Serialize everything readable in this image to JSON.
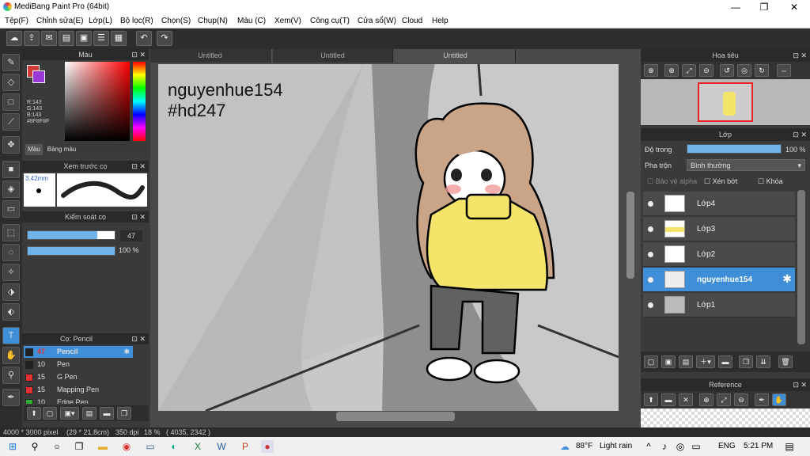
{
  "window": {
    "title": "MediBang Paint Pro (64bit)",
    "min": "—",
    "max": "❐",
    "close": "✕"
  },
  "menu": [
    "Tệp(F)",
    "Chỉnh sửa(E)",
    "Lớp(L)",
    "Bộ lọc(R)",
    "Chọn(S)",
    "Chụp(N)",
    "Màu (C)",
    "Xem(V)",
    "Công cụ(T)",
    "Cửa sổ(W)",
    "Cloud",
    "Help"
  ],
  "tabs": [
    "Untitled",
    "Untitled",
    "Untitled"
  ],
  "color_panel": {
    "title": "Màu",
    "r": "R:143",
    "g": "G:143",
    "b": "B:143",
    "hex": "#8F8F8F",
    "tab1": "Màu",
    "tab2": "Bảng màu",
    "fg": "#d33a3a",
    "bg": "#9b3ad6"
  },
  "brush_preview": {
    "title": "Xem trước cọ",
    "size": "3.42mm"
  },
  "brush_control": {
    "title": "Kiểm soát cọ",
    "size_value": "47",
    "opacity_value": "100 %",
    "size_fraction": 0.8,
    "opacity_fraction": 1.0
  },
  "brushes": {
    "title": "Cọ: Pencil",
    "items": [
      {
        "size": "47",
        "name": "Pencil",
        "color": "#222222"
      },
      {
        "size": "10",
        "name": "Pen",
        "color": "#222222"
      },
      {
        "size": "15",
        "name": "G Pen",
        "color": "#e03030"
      },
      {
        "size": "15",
        "name": "Mapping Pen",
        "color": "#e03030"
      },
      {
        "size": "10",
        "name": "Edge Pen",
        "color": "#30b030"
      }
    ]
  },
  "canvas_text": {
    "line1": "nguyenhue154",
    "line2": "#hd247"
  },
  "navigator": {
    "title": "Hoa tiêu"
  },
  "layers_panel": {
    "title": "Lớp",
    "opacity_label": "Độ trong",
    "opacity_value": "100 %",
    "opacity_fraction": 1.0,
    "blend_label": "Pha trộn",
    "blend_value": "Bình thường",
    "protect_alpha": "Bảo vệ alpha",
    "clipping": "Xén bớt",
    "lock": "Khóa",
    "layers": [
      {
        "name": "Lớp4"
      },
      {
        "name": "Lớp3"
      },
      {
        "name": "Lớp2"
      },
      {
        "name": "nguyenhue154"
      },
      {
        "name": "Lớp1"
      }
    ]
  },
  "reference": {
    "title": "Reference"
  },
  "status": {
    "size": "4000 * 3000 pixel",
    "cm": "(29 * 21.8cm)",
    "dpi": "350 dpi",
    "zoom": "18 %",
    "coords": "( 4035, 2342 )"
  },
  "taskbar": {
    "weather_temp": "88°F",
    "weather_text": "Light rain",
    "lang": "ENG",
    "time": "5:21 PM"
  }
}
